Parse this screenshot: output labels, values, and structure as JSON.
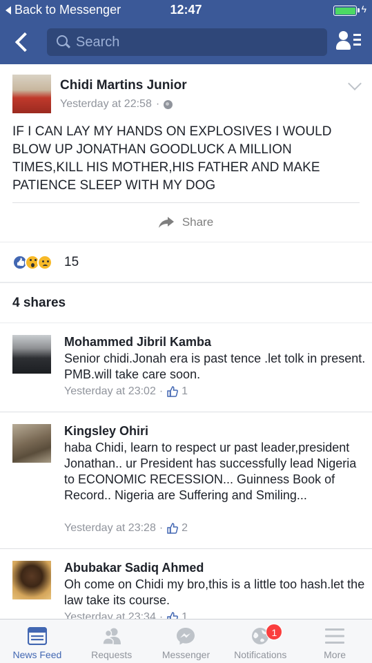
{
  "status_bar": {
    "back_label": "Back to Messenger",
    "time": "12:47",
    "battery_color": "#4cd964"
  },
  "nav": {
    "back_icon": "chevron-left-icon",
    "search_placeholder": "Search",
    "friends_icon": "friend-requests-icon"
  },
  "post": {
    "author": "Chidi Martins Junior",
    "timestamp": "Yesterday at 22:58",
    "privacy_separator": "·",
    "privacy_icon": "globe-icon",
    "text": "IF I CAN LAY MY HANDS ON EXPLOSIVES I WOULD BLOW UP JONATHAN GOODLUCK A MILLION TIMES,KILL HIS MOTHER,HIS FATHER AND MAKE PATIENCE SLEEP WITH MY DOG",
    "share_label": "Share"
  },
  "reactions": {
    "types": [
      "like",
      "wow",
      "sad"
    ],
    "count": "15"
  },
  "shares": {
    "label": "4 shares"
  },
  "comments": [
    {
      "name": "Mohammed Jibril Kamba",
      "text": "Senior chidi.Jonah era is past tence .let tolk in present. PMB.will take care soon.",
      "timestamp": "Yesterday at 23:02",
      "separator": "·",
      "likes": "1"
    },
    {
      "name": "Kingsley Ohiri",
      "text": "haba Chidi, learn to respect ur past leader,president Jonathan.. ur President has successfully lead Nigeria to ECONOMIC RECESSION... Guinness Book of Record.. Nigeria are Suffering and Smiling...",
      "timestamp": "Yesterday at 23:28",
      "separator": "·",
      "likes": "2"
    },
    {
      "name": "Abubakar Sadiq Ahmed",
      "text": "Oh come on Chidi my bro,this is a little too hash.let the law take its course.",
      "timestamp": "Yesterday at 23:34",
      "separator": "·",
      "likes": "1"
    }
  ],
  "tabs": [
    {
      "label": "News Feed",
      "icon": "news-feed-icon",
      "active": true
    },
    {
      "label": "Requests",
      "icon": "requests-icon",
      "active": false
    },
    {
      "label": "Messenger",
      "icon": "messenger-icon",
      "active": false
    },
    {
      "label": "Notifications",
      "icon": "globe-notifications-icon",
      "active": false,
      "badge": "1"
    },
    {
      "label": "More",
      "icon": "menu-icon",
      "active": false
    }
  ],
  "colors": {
    "brand_blue": "#3b5998",
    "active_tab": "#4267b2",
    "badge_red": "#fa3e3e",
    "meta_gray": "#90949c"
  }
}
